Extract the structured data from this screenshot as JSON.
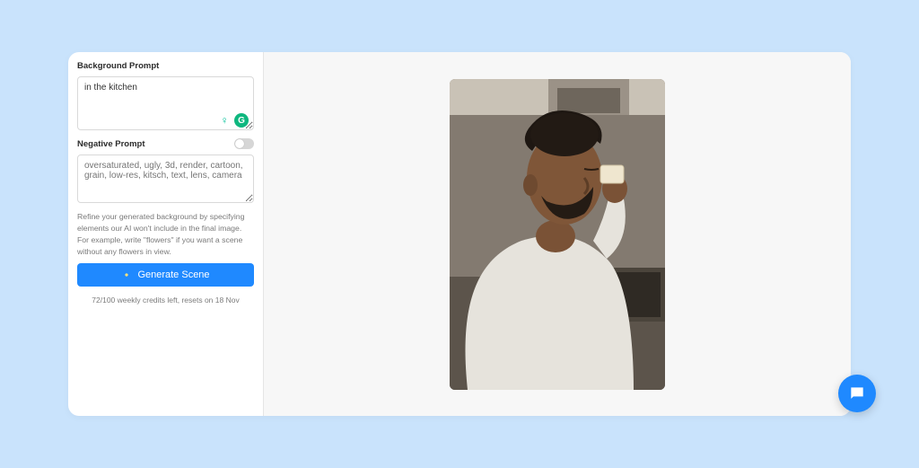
{
  "sidebar": {
    "bg_label": "Background Prompt",
    "bg_value": "in the kitchen",
    "neg_label": "Negative Prompt",
    "neg_placeholder": "oversaturated, ugly, 3d, render, cartoon, grain, low-res, kitsch, text, lens, camera",
    "help_text": "Refine your generated background by specifying elements our AI won't include in the final image. For example, write \"flowers\" if you want a scene without any flowers in view.",
    "generate_label": "Generate Scene",
    "credits_text": "72/100 weekly credits left, resets on 18 Nov",
    "grammarly_letter": "G"
  }
}
